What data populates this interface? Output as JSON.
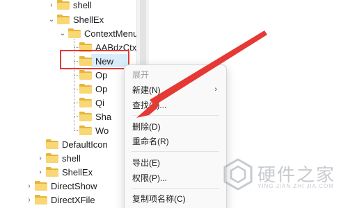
{
  "tree": {
    "items": [
      {
        "label": "shell"
      },
      {
        "label": "ShellEx"
      },
      {
        "label": "ContextMenu"
      },
      {
        "label": "AABdzCtx"
      },
      {
        "label": "New"
      },
      {
        "label": "Op"
      },
      {
        "label": "Op"
      },
      {
        "label": "Qi"
      },
      {
        "label": "Sha"
      },
      {
        "label": "Wo"
      },
      {
        "label": "DefaultIcon"
      },
      {
        "label": "shell"
      },
      {
        "label": "ShellEx"
      },
      {
        "label": "DirectShow"
      },
      {
        "label": "DirectXFile"
      }
    ]
  },
  "context_menu": {
    "header": "展开",
    "items": [
      {
        "label": "新建(N)"
      },
      {
        "label": "查找(F)..."
      },
      {
        "label": "删除(D)"
      },
      {
        "label": "重命名(R)"
      },
      {
        "label": "导出(E)"
      },
      {
        "label": "权限(P)..."
      },
      {
        "label": "复制项名称(C)"
      }
    ],
    "submenu_arrow": "›"
  },
  "watermark": {
    "title": "硬件之家",
    "subtitle": "YING JIAN ZHI JIA.COM"
  },
  "colors": {
    "highlight_box": "#e53935",
    "arrow": "#e53935",
    "selected": "#d9ecfa",
    "folder": "#f8d775"
  }
}
